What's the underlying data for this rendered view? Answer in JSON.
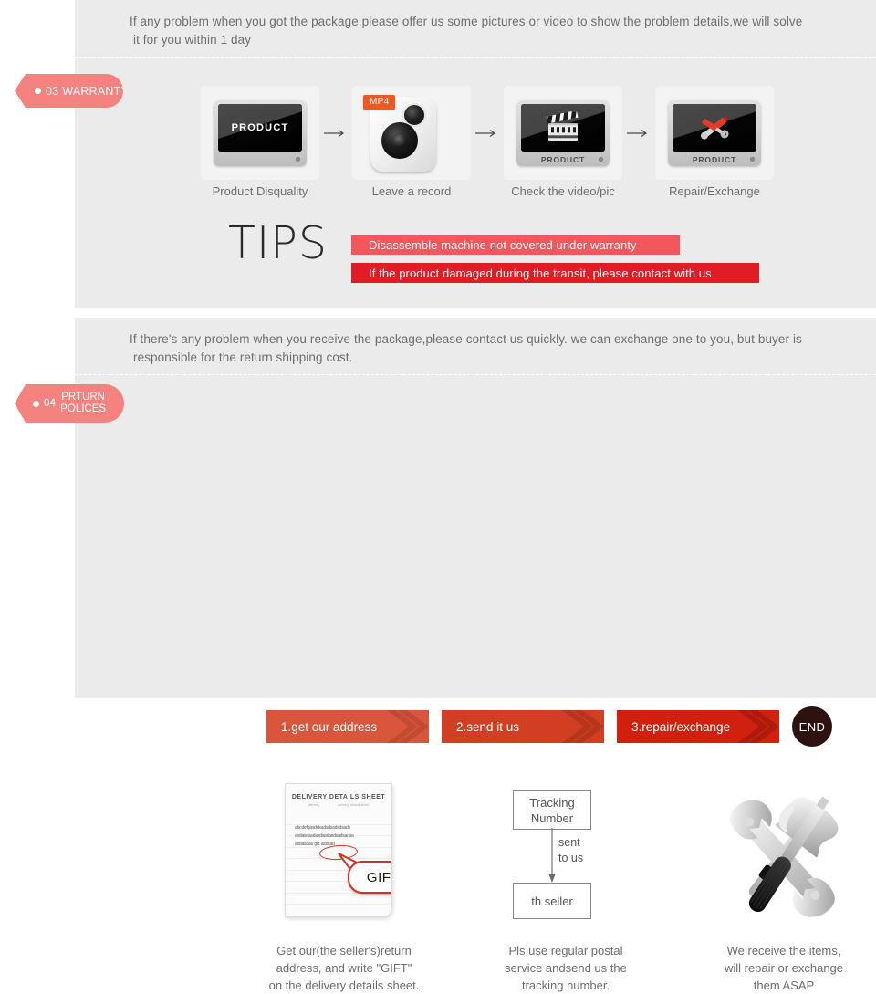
{
  "theme": {
    "panel_bg": "#ebebeb",
    "page_bg": "#ffffff",
    "tag_pink": "#f4827f",
    "tips_light_red": "#f4565b",
    "tips_strong_red": "#e01c24",
    "step_1": "#d9563d",
    "step_2": "#d23e22",
    "step_3": "#d2200e",
    "end_dark": "#2e1210",
    "body_text": "#6e6e6e",
    "mp4_badge": "#ec5a21"
  },
  "warranty": {
    "tag": {
      "number": "03",
      "label": "WARRANTY",
      "bullet_icon": "dot-icon"
    },
    "intro_line1": "If any problem when you got the package,please offer us some pictures or video to show the problem details,we will solve",
    "intro_line2": "it for you within 1 day",
    "steps": [
      {
        "caption": "Product Disquality",
        "icon": "monitor-icon",
        "screen_text": "PRODUCT",
        "bezel_text": ""
      },
      {
        "caption": "Leave a record",
        "icon": "mp4-recorder-icon",
        "badge": "MP4"
      },
      {
        "caption": "Check the video/pic",
        "icon": "monitor-clapperboard-icon",
        "screen_text": "",
        "bezel_text": "PRODUCT"
      },
      {
        "caption": "Repair/Exchange",
        "icon": "monitor-tools-icon",
        "screen_text": "",
        "bezel_text": "PRODUCT"
      }
    ],
    "arrow_icon": "arrow-right-icon",
    "tips": {
      "heading": "TIPS",
      "bar1": "Disassemble machine not covered under warranty",
      "bar2": "If the product damaged during the transit, please contact with us"
    }
  },
  "return_policies": {
    "tag": {
      "number": "04",
      "label_line1": "PRTURN",
      "label_line2": "POLICES",
      "bullet_icon": "dot-icon"
    },
    "intro_line1": "If  there's any problem when you receive the package,please contact us quickly. we can exchange one to you, but buyer is",
    "intro_line2": "responsible for the return shipping cost.",
    "steps": [
      {
        "label": "1.get our address"
      },
      {
        "label": "2.send it us"
      },
      {
        "label": "3.repair/exchange"
      }
    ],
    "end_label": "END",
    "columns": [
      {
        "icon": "delivery-details-sheet-icon",
        "sheet": {
          "title": "DELIVERY DETAILS SHEET",
          "sub_left": "delivery",
          "sub_right": "delivery details sheet",
          "body_line1": "abcdefgasddsadsdsadsdsads",
          "body_line2": "asdasdasdasdasdasdsadsadsa",
          "body_line3": "asdasdas\"gift\"asdsad",
          "callout": "GIFT"
        },
        "caption_line1": "Get our(the seller's)return",
        "caption_line2": "address, and write \"GIFT\"",
        "caption_line3": "on the delivery details sheet."
      },
      {
        "icon": "tracking-flow-icon",
        "flow": {
          "box_top_line1": "Tracking",
          "box_top_line2": "Number",
          "arrow_label_line1": "sent",
          "arrow_label_line2": "to us",
          "box_bottom": "th seller",
          "arrow_icon": "arrow-down-icon"
        },
        "caption_line1": "Pls use regular postal",
        "caption_line2": "service andsend us the",
        "caption_line3": "tracking number."
      },
      {
        "icon": "hammer-wrench-screwdriver-icon",
        "caption_line1": "We receive the items,",
        "caption_line2": "will repair or exchange",
        "caption_line3": "them ASAP"
      }
    ]
  }
}
